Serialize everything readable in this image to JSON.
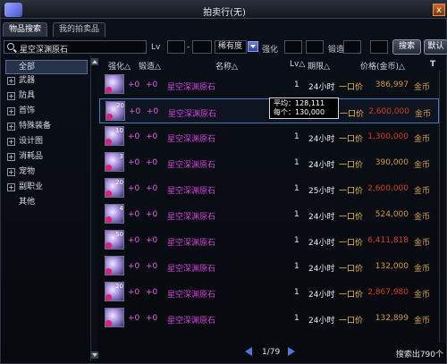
{
  "window": {
    "title": "拍卖行(无)",
    "close_label": "x"
  },
  "tabs": [
    {
      "label": "物品搜索",
      "active": true
    },
    {
      "label": "我的拍卖品",
      "active": false
    }
  ],
  "search": {
    "query": "星空深渊原石",
    "lv_label": "Lv",
    "lv_sep": "-",
    "rarity_value": "稀有度",
    "enhance_label": "强化",
    "forge_label": "锻造",
    "search_button": "搜索",
    "default_button": "默认"
  },
  "sidebar": {
    "items": [
      {
        "label": "全部",
        "selected": true,
        "expandable": false
      },
      {
        "label": "武器",
        "selected": false,
        "expandable": true
      },
      {
        "label": "防具",
        "selected": false,
        "expandable": true
      },
      {
        "label": "首饰",
        "selected": false,
        "expandable": true
      },
      {
        "label": "特殊装备",
        "selected": false,
        "expandable": true
      },
      {
        "label": "设计图",
        "selected": false,
        "expandable": true
      },
      {
        "label": "消耗品",
        "selected": false,
        "expandable": true
      },
      {
        "label": "宠物",
        "selected": false,
        "expandable": true
      },
      {
        "label": "副职业",
        "selected": false,
        "expandable": true
      },
      {
        "label": "其他",
        "selected": false,
        "expandable": false
      }
    ]
  },
  "columns": {
    "enhance": "强化△",
    "forge": "锻造△",
    "name": "名称△",
    "lv": "Lv△",
    "duration": "期限△",
    "price": "价格(金币)△",
    "pin_icon": "T"
  },
  "rows": [
    {
      "qty": "",
      "enhance": "+0",
      "forge": "+0",
      "name": "星空深渊原石",
      "lv": "1",
      "time": "24小时",
      "once": "一口价",
      "price": "386,997",
      "unit": "金币",
      "price_red": false
    },
    {
      "qty": "20",
      "enhance": "+0",
      "forge": "+0",
      "name": "星空深渊原石",
      "lv": "1",
      "time": "",
      "once": "一口价",
      "price": "2,600,000",
      "unit": "金币",
      "price_red": true
    },
    {
      "qty": "10",
      "enhance": "+0",
      "forge": "+0",
      "name": "星空深渊原石",
      "lv": "1",
      "time": "24小时",
      "once": "一口价",
      "price": "1,300,000",
      "unit": "金币",
      "price_red": true
    },
    {
      "qty": "3",
      "enhance": "+0",
      "forge": "+0",
      "name": "星空深渊原石",
      "lv": "1",
      "time": "24小时",
      "once": "一口价",
      "price": "390,000",
      "unit": "金币",
      "price_red": false
    },
    {
      "qty": "20",
      "enhance": "+0",
      "forge": "+0",
      "name": "星空深渊原石",
      "lv": "1",
      "time": "25小时",
      "once": "一口价",
      "price": "2,600,000",
      "unit": "金币",
      "price_red": true
    },
    {
      "qty": "4",
      "enhance": "+0",
      "forge": "+0",
      "name": "星空深渊原石",
      "lv": "1",
      "time": "24小时",
      "once": "一口价",
      "price": "524,000",
      "unit": "金币",
      "price_red": false
    },
    {
      "qty": "50",
      "enhance": "+0",
      "forge": "+0",
      "name": "星空深渊原石",
      "lv": "1",
      "time": "24小时",
      "once": "一口价",
      "price": "6,411,818",
      "unit": "金币",
      "price_red": true
    },
    {
      "qty": "",
      "enhance": "+0",
      "forge": "+0",
      "name": "星空深渊原石",
      "lv": "1",
      "time": "24小时",
      "once": "一口价",
      "price": "132,000",
      "unit": "金币",
      "price_red": false
    },
    {
      "qty": "20",
      "enhance": "+0",
      "forge": "+0",
      "name": "星空深渊原石",
      "lv": "1",
      "time": "24小时",
      "once": "一口价",
      "price": "2,867,980",
      "unit": "金币",
      "price_red": true
    },
    {
      "qty": "",
      "enhance": "+0",
      "forge": "+0",
      "name": "星空深渊原石",
      "lv": "1",
      "time": "24小时",
      "once": "一口价",
      "price": "132,899",
      "unit": "金币",
      "price_red": false
    }
  ],
  "tooltip": {
    "avg_label": "平均：",
    "avg_value": "128,111",
    "each_label": "每个：",
    "each_value": "130,000"
  },
  "pager": {
    "text": "1/79"
  },
  "footer": {
    "total": "搜索出790个"
  },
  "colors": {
    "price_gold": "#d09a38",
    "price_red": "#d83a20",
    "item_name": "#d040d8",
    "once_label": "#f0c040",
    "selection_border": "#4d7ab8"
  }
}
